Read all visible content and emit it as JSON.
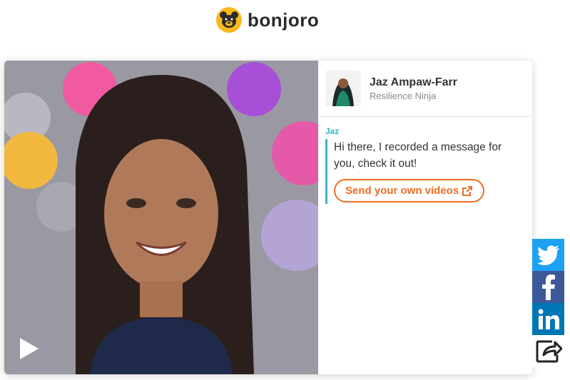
{
  "brand": {
    "name": "bonjoro",
    "logo_icon": "bear-logo-icon",
    "accent": "#f9b91d"
  },
  "video": {
    "play_icon": "play-icon"
  },
  "sender": {
    "name": "Jaz Ampaw-Farr",
    "title": "Resilience Ninja"
  },
  "message": {
    "from": "Jaz",
    "text": "Hi there, I recorded a message for you, check it out!",
    "cta_label": "Send your own videos",
    "cta_icon": "external-link-icon",
    "accent": "#3bb3c3",
    "cta_color": "#f06c22"
  },
  "share": [
    {
      "name": "twitter",
      "icon": "twitter-icon",
      "color": "#1da1f2"
    },
    {
      "name": "facebook",
      "icon": "facebook-icon",
      "color": "#3b5998"
    },
    {
      "name": "linkedin",
      "icon": "linkedin-icon",
      "color": "#0077b5"
    },
    {
      "name": "share",
      "icon": "share-icon",
      "color": "#ffffff"
    }
  ]
}
